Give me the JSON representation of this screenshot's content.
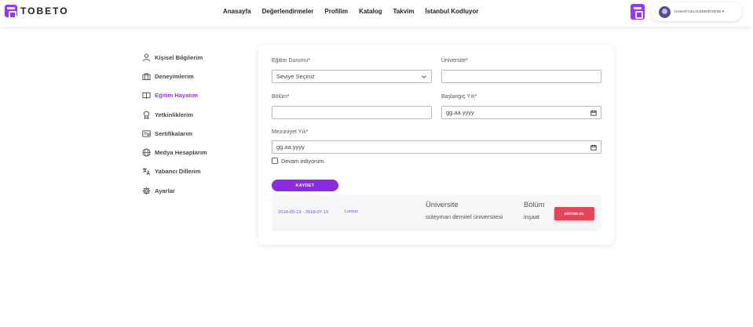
{
  "brand": {
    "name": "TOBETO"
  },
  "nav": {
    "items": [
      "Anasayfa",
      "Değerlendirmeler",
      "Profilim",
      "Katalog",
      "Takvim",
      "İstanbul Kodluyor"
    ]
  },
  "user": {
    "name": "HASAN CELALEDDİN KESE ▾"
  },
  "sidebar": {
    "items": [
      {
        "label": "Kişisel Bilgilerim",
        "icon": "user-icon"
      },
      {
        "label": "Deneyimlerim",
        "icon": "briefcase-icon"
      },
      {
        "label": "Eğitim Hayatım",
        "icon": "book-icon"
      },
      {
        "label": "Yetkinliklerim",
        "icon": "award-icon"
      },
      {
        "label": "Sertifikalarım",
        "icon": "certificate-icon"
      },
      {
        "label": "Medya Hesaplarım",
        "icon": "globe-icon"
      },
      {
        "label": "Yabancı Dillerim",
        "icon": "translate-icon"
      },
      {
        "label": "Ayarlar",
        "icon": "gear-icon"
      }
    ],
    "active_index": 2
  },
  "form": {
    "education_status_label": "Eğitim Durumu*",
    "education_status_value": "Seviye Seçiniz",
    "university_label": "Üniversite*",
    "university_value": "",
    "department_label": "Bölüm*",
    "department_value": "",
    "start_year_label": "Başlangıç Yılı*",
    "start_year_placeholder": "gg.aa.yyyy",
    "grad_year_label": "Mezuniyet Yılı*",
    "grad_year_placeholder": "gg.aa.yyyy",
    "ongoing_label": "Devam ediyorum.",
    "save_label": "KAYDET"
  },
  "record": {
    "dates": "2014-09-13 - 2018-07-15",
    "degree": "Lisans",
    "university_header": "Üniversite",
    "university_value": "süleyman demirel üniversitesi",
    "department_header": "Bölüm",
    "department_value": "inşaat",
    "delete_label": "EĞİTİMİ SİL"
  },
  "colors": {
    "accent": "#9933ff",
    "button": "#8a2be2",
    "danger": "#e0475a"
  }
}
